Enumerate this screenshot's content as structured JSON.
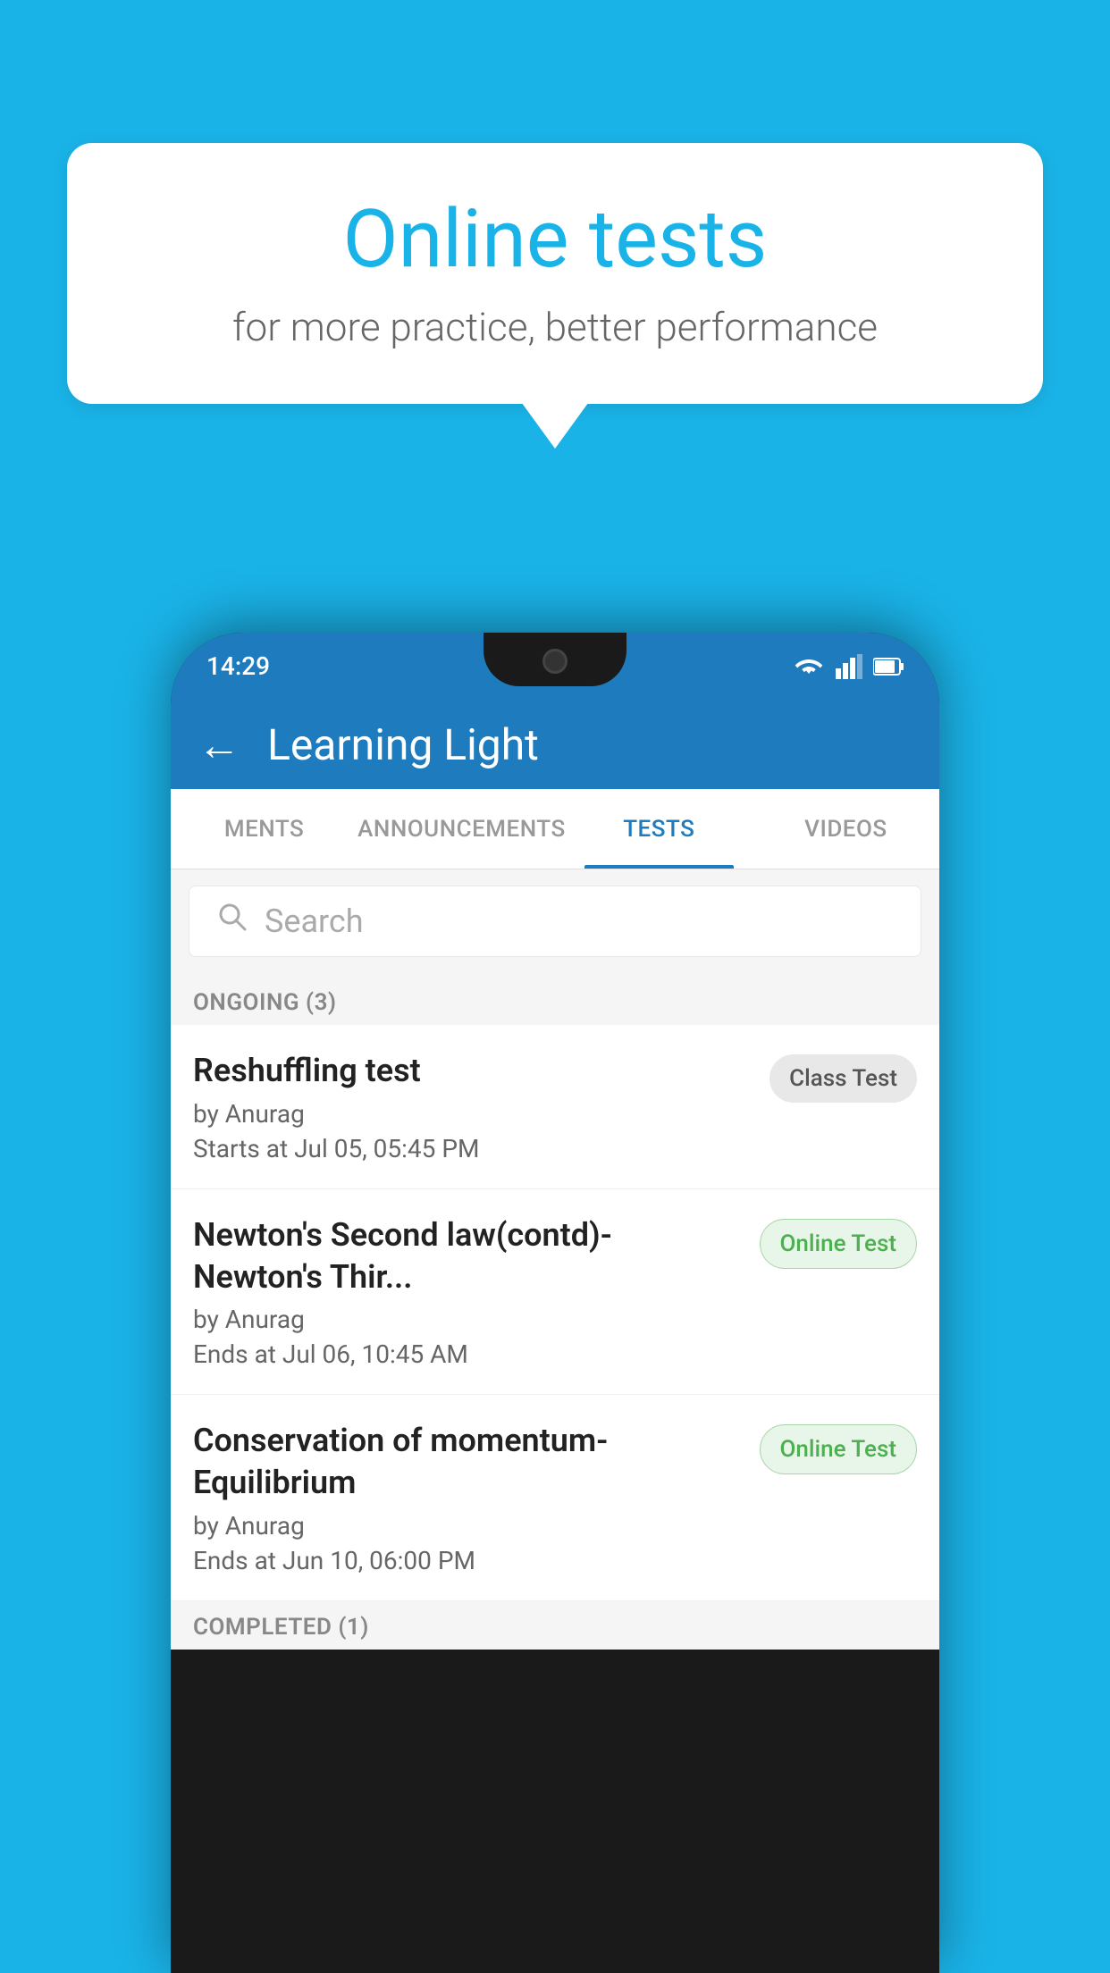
{
  "background_color": "#1ab3e8",
  "speech_bubble": {
    "title": "Online tests",
    "subtitle": "for more practice, better performance"
  },
  "phone": {
    "status_bar": {
      "time": "14:29",
      "icons": [
        "wifi",
        "signal",
        "battery"
      ]
    },
    "app_header": {
      "back_label": "←",
      "title": "Learning Light"
    },
    "tabs": [
      {
        "label": "MENTS",
        "active": false
      },
      {
        "label": "ANNOUNCEMENTS",
        "active": false
      },
      {
        "label": "TESTS",
        "active": true
      },
      {
        "label": "VIDEOS",
        "active": false
      }
    ],
    "search": {
      "placeholder": "Search"
    },
    "ongoing_section": {
      "label": "ONGOING (3)"
    },
    "tests": [
      {
        "title": "Reshuffling test",
        "author": "by Anurag",
        "date_label": "Starts at",
        "date": "Jul 05, 05:45 PM",
        "badge": "Class Test",
        "badge_type": "class"
      },
      {
        "title": "Newton's Second law(contd)-Newton's Thir...",
        "author": "by Anurag",
        "date_label": "Ends at",
        "date": "Jul 06, 10:45 AM",
        "badge": "Online Test",
        "badge_type": "online"
      },
      {
        "title": "Conservation of momentum-Equilibrium",
        "author": "by Anurag",
        "date_label": "Ends at",
        "date": "Jun 10, 06:00 PM",
        "badge": "Online Test",
        "badge_type": "online"
      }
    ],
    "completed_section": {
      "label": "COMPLETED (1)"
    }
  }
}
